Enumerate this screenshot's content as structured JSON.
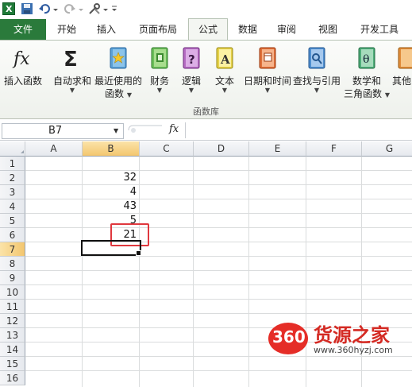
{
  "tabs": [
    "文件",
    "开始",
    "插入",
    "页面布局",
    "公式",
    "数据",
    "审阅",
    "视图",
    "开发工具"
  ],
  "ribbon": {
    "insert_function": "插入函数",
    "autosum": "自动求和",
    "recent_line1": "最近使用的",
    "recent_line2": "函数",
    "financial": "财务",
    "logical": "逻辑",
    "text": "文本",
    "datetime": "日期和时间",
    "lookup": "查找与引用",
    "math_line1": "数学和",
    "math_line2": "三角函数",
    "more": "其他",
    "group_label": "函数库"
  },
  "formula_bar": {
    "name_box": "B7",
    "fx_label": "fx"
  },
  "grid": {
    "columns": [
      "A",
      "B",
      "C",
      "D",
      "E",
      "F",
      "G"
    ],
    "rows": [
      "1",
      "2",
      "3",
      "4",
      "5",
      "6",
      "7",
      "8",
      "9",
      "10",
      "11",
      "12",
      "13",
      "14",
      "15",
      "16"
    ],
    "b_values": [
      "32",
      "4",
      "43",
      "5",
      "21"
    ],
    "selected_cell": "B7"
  },
  "watermark": {
    "logo": "360",
    "brand": "货源之家",
    "url": "www.360hyzj.com"
  },
  "colors": {
    "file_tab": "#2a7a3b",
    "selection_header": "#f3c66f",
    "highlight_box": "#e0383e"
  }
}
